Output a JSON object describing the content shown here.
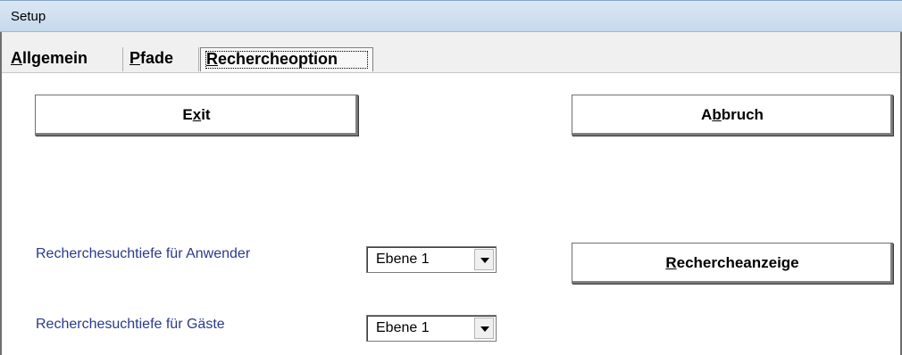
{
  "window": {
    "title": "Setup"
  },
  "tabs": [
    {
      "prefix": "",
      "underline": "A",
      "rest": "llgemein"
    },
    {
      "prefix": "",
      "underline": "P",
      "rest": "fade"
    },
    {
      "prefix": "",
      "underline": "R",
      "rest": "echercheoption"
    }
  ],
  "buttons": {
    "exit": {
      "prefix": "E",
      "underline": "x",
      "rest": "it"
    },
    "abbruch": {
      "prefix": "A",
      "underline": "b",
      "rest": "bruch"
    },
    "rechercheanzeige": {
      "prefix": "",
      "underline": "R",
      "rest": "echercheanzeige"
    }
  },
  "options": {
    "anwender_label": "Recherchesuchtiefe für Anwender",
    "anwender_value": "Ebene 1",
    "gaeste_label": "Recherchesuchtiefe für Gäste",
    "gaeste_value": "Ebene 1"
  },
  "colors": {
    "label_text": "#2a3a8c",
    "title_bar": "#c7d9ee"
  },
  "icons": {
    "dropdown": "chevron-down-icon"
  }
}
